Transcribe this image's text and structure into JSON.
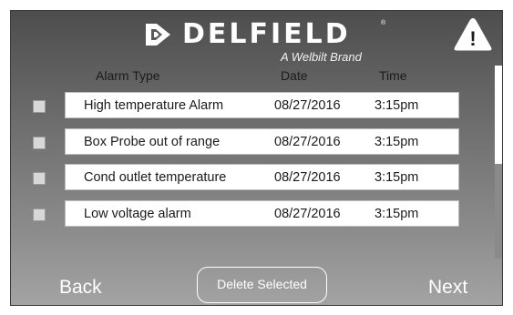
{
  "header": {
    "brand": "DELFIELD",
    "registered_mark": "®",
    "tagline": "A Welbilt Brand",
    "warning_symbol": "!",
    "logo_icon": "delfield-logo-icon",
    "warning_icon": "warning-triangle-icon"
  },
  "columns": {
    "type": "Alarm Type",
    "date": "Date",
    "time": "Time"
  },
  "alarms": [
    {
      "type": "High temperature Alarm",
      "date": "08/27/2016",
      "time": "3:15pm",
      "selected": false
    },
    {
      "type": "Box Probe out of range",
      "date": "08/27/2016",
      "time": "3:15pm",
      "selected": false
    },
    {
      "type": "Cond outlet temperature",
      "date": "08/27/2016",
      "time": "3:15pm",
      "selected": false
    },
    {
      "type": "Low voltage alarm",
      "date": "08/27/2016",
      "time": "3:15pm",
      "selected": false
    }
  ],
  "footer": {
    "back": "Back",
    "delete": "Delete Selected",
    "next": "Next"
  },
  "colors": {
    "background_top": "#4d4d4d",
    "background_bottom": "#a3a3a3",
    "text_light": "#ffffff",
    "row_background": "#ffffff"
  }
}
